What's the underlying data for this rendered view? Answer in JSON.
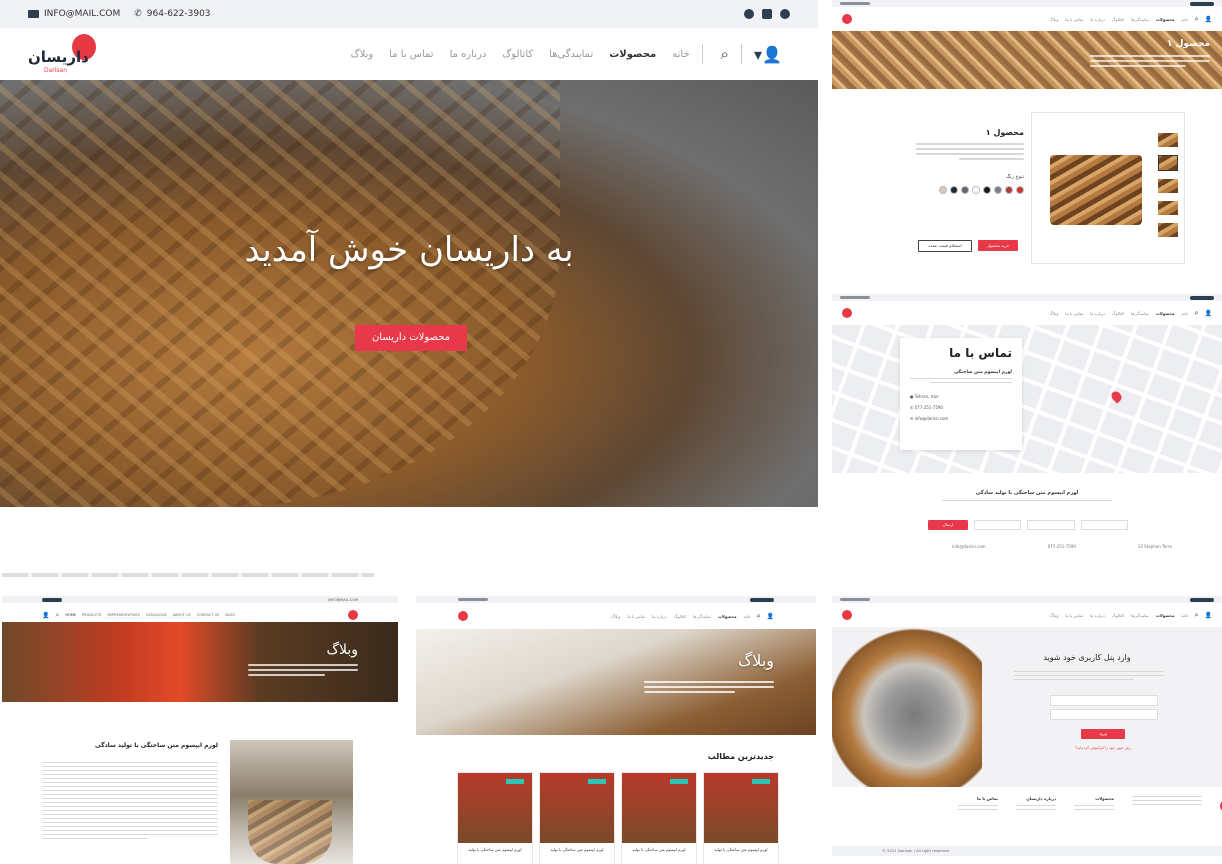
{
  "colors": {
    "accent": "#e8394a",
    "dark": "#1f2a38",
    "teal": "#2ec4b6"
  },
  "main": {
    "email": "INFO@MAIL.COM",
    "phone": "964-622-3903",
    "logo_text": "داریسان",
    "logo_sub": "Darisan",
    "nav": [
      "خانه",
      "محصولات",
      "نمایندگی‌ها",
      "کاتالوگ",
      "درباره ما",
      "تماس با ما",
      "وبلاگ"
    ],
    "hero_title": "به داریسان خوش آمدید",
    "hero_button": "محصولات داریسان"
  },
  "product": {
    "title": "محصول ۱",
    "color_label": "تنوع رنگ",
    "swatches": [
      "#c8372d",
      "#b33a3a",
      "#7a7f86",
      "#1a1a1a",
      "#ffffff",
      "#5f6670",
      "#1e2833",
      "#d8c7c0"
    ],
    "buy_button": "خرید محصول",
    "inquiry_button": "استعلام قیمت عمده",
    "banner_title": "محصول ۱"
  },
  "contact": {
    "title": "تماس با ما",
    "subtitle": "لورم ایپسوم متن ساختگی",
    "address": "Tehran, Iran",
    "phone": "077-251-7590",
    "email": "info@darisn.com",
    "form_title": "لورم ایپسوم متن ساختگی با تولید سادگی",
    "send_button": "ارسال",
    "footer_email": "info@darisn.com",
    "footer_phone": "077-251-7590",
    "footer_address": "33 Stephen Terra"
  },
  "blog_en": {
    "nav": [
      "HOME",
      "PRODUCTS",
      "REPRESENTATIVES",
      "CATALOGUE",
      "ABOUT US",
      "CONTACT US",
      "BLOG"
    ],
    "email": "INFO@MAIL.COM",
    "title": "وبلاگ",
    "article_title": "لورم ایپسوم متن ساختگی با تولید سادگی"
  },
  "blog_fa": {
    "title": "وبلاگ",
    "latest": "جدیدترین مطالب",
    "card_title": "لورم ایپسوم متن ساختگی با تولید"
  },
  "login": {
    "title": "وارد پنل کاربری خود شوید",
    "submit": "ورود",
    "forgot": "رمز عبور خود را فراموش کرده‌اید؟",
    "footer_cols": [
      "تماس با ما",
      "درباره داریسان",
      "محصولات"
    ],
    "copyright": "© 2021 Darisan | All right reserved"
  }
}
